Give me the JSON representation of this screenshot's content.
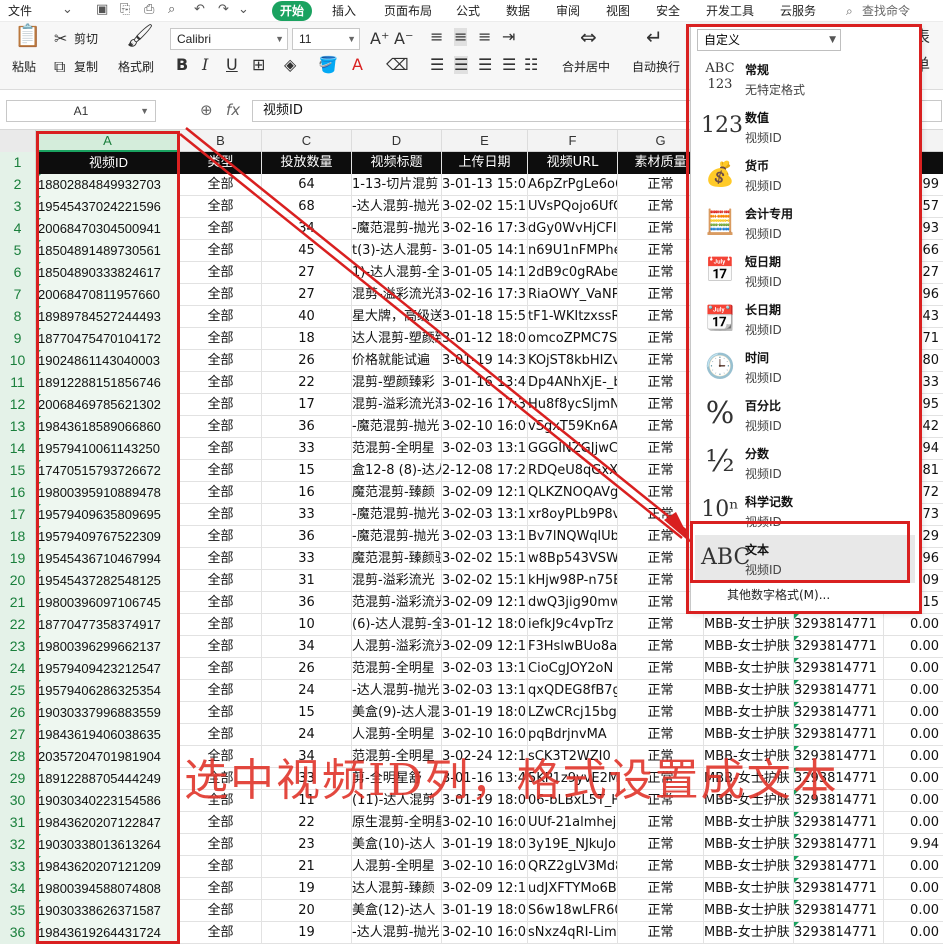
{
  "menubar": {
    "items": [
      "文件",
      "开始",
      "插入",
      "页面布局",
      "公式",
      "数据",
      "审阅",
      "视图",
      "安全",
      "开发工具",
      "云服务"
    ],
    "active": "开始",
    "search": "查找命令"
  },
  "ribbon": {
    "paste": "粘贴",
    "cut": "剪切",
    "copy": "复制",
    "format_painter": "格式刷",
    "font_name": "Calibri",
    "font_size": "11",
    "merge_center": "合并居中",
    "wrap_text": "自动换行",
    "number_format": "自定义"
  },
  "formula_bar": {
    "cell_ref": "A1",
    "fx": "fx",
    "value": "视频ID"
  },
  "columns": [
    "A",
    "B",
    "C",
    "D",
    "E",
    "F",
    "G",
    "H",
    "I",
    "J"
  ],
  "header_row": [
    "视频ID",
    "类型",
    "投放数量",
    "视频标题",
    "上传日期",
    "视频URL",
    "素材质量",
    "",
    "",
    "OI"
  ],
  "rows": [
    [
      "18802884849932703",
      "全部",
      "64",
      "1-13-切片混剪",
      "3-01-13 15:0",
      "A6pZrPgLe6o6",
      "正常",
      "",
      "",
      "99"
    ],
    [
      "19545437024221596",
      "全部",
      "68",
      "-达人混剪-抛光",
      "3-02-02 15:1",
      "UVsPQojo6UfC",
      "正常",
      "",
      "",
      "57"
    ],
    [
      "20068470304500941",
      "全部",
      "34",
      "-魔范混剪-抛光",
      "3-02-16 17:34",
      "dGy0WvHjCFI",
      "正常",
      "",
      "",
      "93"
    ],
    [
      "18504891489730561",
      "全部",
      "45",
      "t(3)-达人混剪-",
      "3-01-05 14:19",
      "n69U1nFMPhe",
      "正常",
      "",
      "",
      "66"
    ],
    [
      "18504890333824617",
      "全部",
      "27",
      "1)-达人混剪-全",
      "3-01-05 14:19",
      "2dB9c0gRAbe",
      "正常",
      "",
      "",
      "27"
    ],
    [
      "20068470811957660",
      "全部",
      "27",
      "混剪-溢彩流光渐",
      "3-02-16 17:3",
      "RiaOWY_VaNP",
      "正常",
      "",
      "",
      "96"
    ],
    [
      "18989784527244493",
      "全部",
      "40",
      "星大牌，高级送",
      "3-01-18 15:5",
      "tF1-WKItzxssR",
      "正常",
      "",
      "",
      "43"
    ],
    [
      "18770475470104172",
      "全部",
      "18",
      "达人混剪-塑颜臻",
      "3-01-12 18:0",
      "omcoZPMC7S",
      "正常",
      "",
      "",
      "71"
    ],
    [
      "19024861143040003",
      "全部",
      "26",
      "价格就能试遍",
      "3-01-19 14:37",
      "KOjST8kbHIZv",
      "正常",
      "",
      "",
      "80"
    ],
    [
      "18912288151856746",
      "全部",
      "22",
      "混剪-塑颜臻彩",
      "3-01-16 13:40",
      "Dp4ANhXjE-_b",
      "正常",
      "",
      "",
      "33"
    ],
    [
      "20068469785621302",
      "全部",
      "17",
      "混剪-溢彩流光渐",
      "3-02-16 17:3",
      "Hu8f8ycSljmN",
      "正常",
      "",
      "",
      ".95"
    ],
    [
      "19843618589066860",
      "全部",
      "36",
      "-魔范混剪-抛光",
      "3-02-10 16:09",
      "vSgxT59Kn6A",
      "正常",
      "",
      "",
      "42"
    ],
    [
      "19579410061143250",
      "全部",
      "33",
      "范混剪-全明星",
      "3-02-03 13:1",
      "GGGINZGJjwC",
      "正常",
      "",
      "",
      "94"
    ],
    [
      "17470515793726672",
      "全部",
      "15",
      "盒12-8 (8)-达人",
      "2-12-08 17:20",
      "RDQeU8qGxX",
      "正常",
      "",
      "",
      "81"
    ],
    [
      "19800395910889478",
      "全部",
      "16",
      "魔范混剪-臻颜",
      "3-02-09 12:1",
      "QLKZNOQAVg",
      "正常",
      "",
      "",
      "72"
    ],
    [
      "19579409635809695",
      "全部",
      "33",
      "-魔范混剪-抛光",
      "3-02-03 13:1",
      "xr8oyPLb9P8v",
      "正常",
      "",
      "",
      "73"
    ],
    [
      "19579409767522309",
      "全部",
      "36",
      "-魔范混剪-抛光",
      "3-02-03 13:1",
      "Bv7lNQWqlUb",
      "正常",
      "",
      "",
      "29"
    ],
    [
      "19545436710467994",
      "全部",
      "33",
      "魔范混剪-臻颜驻",
      "3-02-02 15:1",
      "w8Bp543VSWI",
      "正常",
      "",
      "",
      "96"
    ],
    [
      "19545437282548125",
      "全部",
      "31",
      "混剪-溢彩流光",
      "3-02-02 15:1",
      "kHjw98P-n75E",
      "正常",
      "",
      "",
      "09"
    ],
    [
      "19800396097106745",
      "全部",
      "36",
      "范混剪-溢彩流光",
      "3-02-09 12:1",
      "dwQ3jig90mw",
      "正常",
      "",
      "",
      "15"
    ],
    [
      "18770477358374917",
      "全部",
      "10",
      "(6)-达人混剪-全",
      "3-01-12 18:0",
      "iefkJ9c4vpTrz",
      "正常",
      "MBB-女士护肤",
      "3293814771",
      "0.00"
    ],
    [
      "19800396299662137",
      "全部",
      "34",
      "人混剪-溢彩流光",
      "3-02-09 12:1",
      "F3HslwBUo8a",
      "正常",
      "MBB-女士护肤",
      "3293814771",
      "0.00"
    ],
    [
      "19579409423212547",
      "全部",
      "26",
      "范混剪-全明星",
      "3-02-03 13:1",
      "CioCgJOY2oN",
      "正常",
      "MBB-女士护肤",
      "3293814771",
      "0.00"
    ],
    [
      "19579406286325354",
      "全部",
      "24",
      "-达人混剪-抛光",
      "3-02-03 13:1",
      "qxQDEG8fB7g",
      "正常",
      "MBB-女士护肤",
      "3293814771",
      "0.00"
    ],
    [
      "19030337996883559",
      "全部",
      "15",
      "美盒(9)-达人混",
      "3-01-19 18:0",
      "LZwCRcj15bg",
      "正常",
      "MBB-女士护肤",
      "3293814771",
      "0.00"
    ],
    [
      "19843619406038635",
      "全部",
      "24",
      "人混剪-全明星",
      "3-02-10 16:0",
      "pqBdrjnvMA",
      "正常",
      "MBB-女士护肤",
      "3293814771",
      "0.00"
    ],
    [
      "20357204701981904",
      "全部",
      "34",
      "范混剪-全明星",
      "3-02-24 12:18",
      "sCK3T2WZI0",
      "正常",
      "MBB-女士护肤",
      "3293814771",
      "0.00"
    ],
    [
      "18912288705444249",
      "全部",
      "33",
      "剪-全明星舒",
      "3-01-16 13:4",
      "5KP1z9yvE2M",
      "正常",
      "MBB-女士护肤",
      "3293814771",
      "0.00"
    ],
    [
      "19030340223154586",
      "全部",
      "11",
      "(11)-达人混剪",
      "3-01-19 18:0",
      "06-bLBxL5T_H",
      "正常",
      "MBB-女士护肤",
      "3293814771",
      "0.00"
    ],
    [
      "19843620207122847",
      "全部",
      "22",
      "原生混剪-全明星",
      "3-02-10 16:0",
      "UUf-21almhej",
      "正常",
      "MBB-女士护肤",
      "3293814771",
      "0.00"
    ],
    [
      "19030338013613264",
      "全部",
      "23",
      "美盒(10)-达人",
      "3-01-19 18:0",
      "3y19E_NJkuJo",
      "正常",
      "MBB-女士护肤",
      "3293814771",
      "9.94"
    ],
    [
      "19843620207121209",
      "全部",
      "21",
      "人混剪-全明星",
      "3-02-10 16:0",
      "QRZ2gLV3Md8",
      "正常",
      "MBB-女士护肤",
      "3293814771",
      "0.00"
    ],
    [
      "19800394588074808",
      "全部",
      "19",
      "达人混剪-臻颜",
      "3-02-09 12:1",
      "udJXFTYMo6B",
      "正常",
      "MBB-女士护肤",
      "3293814771",
      "0.00"
    ],
    [
      "19030338626371587",
      "全部",
      "20",
      "美盒(12)-达人",
      "3-01-19 18:0",
      "S6w18wLFR60",
      "正常",
      "MBB-女士护肤",
      "3293814771",
      "0.00"
    ],
    [
      "19843619264431724",
      "全部",
      "19",
      "-达人混剪-抛光",
      "3-02-10 16:09",
      "sNxz4qRI-Lim",
      "正常",
      "MBB-女士护肤",
      "3293814771",
      "0.00"
    ]
  ],
  "format_menu": {
    "search_value": "自定义",
    "options": [
      {
        "name": "常规",
        "value": "无特定格式",
        "icon": "general-format-icon",
        "glyph": "ABC\n123"
      },
      {
        "name": "数值",
        "value": "视频ID",
        "icon": "number-format-icon",
        "glyph": "123"
      },
      {
        "name": "货币",
        "value": "视频ID",
        "icon": "currency-format-icon",
        "glyph": ""
      },
      {
        "name": "会计专用",
        "value": "视频ID",
        "icon": "accounting-format-icon",
        "glyph": ""
      },
      {
        "name": "短日期",
        "value": "视频ID",
        "icon": "short-date-icon",
        "glyph": ""
      },
      {
        "name": "长日期",
        "value": "视频ID",
        "icon": "long-date-icon",
        "glyph": ""
      },
      {
        "name": "时间",
        "value": "视频ID",
        "icon": "clock-icon",
        "glyph": ""
      },
      {
        "name": "百分比",
        "value": "视频ID",
        "icon": "percent-icon",
        "glyph": "%"
      },
      {
        "name": "分数",
        "value": "视频ID",
        "icon": "fraction-icon",
        "glyph": "½"
      },
      {
        "name": "科学记数",
        "value": "视频ID",
        "icon": "scientific-icon",
        "glyph": "10ⁿ"
      },
      {
        "name": "文本",
        "value": "视频ID",
        "icon": "text-format-icon",
        "glyph": "ABC"
      }
    ],
    "more": "其他数字格式(M)..."
  },
  "annotation": "选中视频ID列，格式设置成文本",
  "colors": {
    "accent": "#1aa260",
    "annotation_red": "#d92020",
    "header_black": "#0d0d0d"
  }
}
